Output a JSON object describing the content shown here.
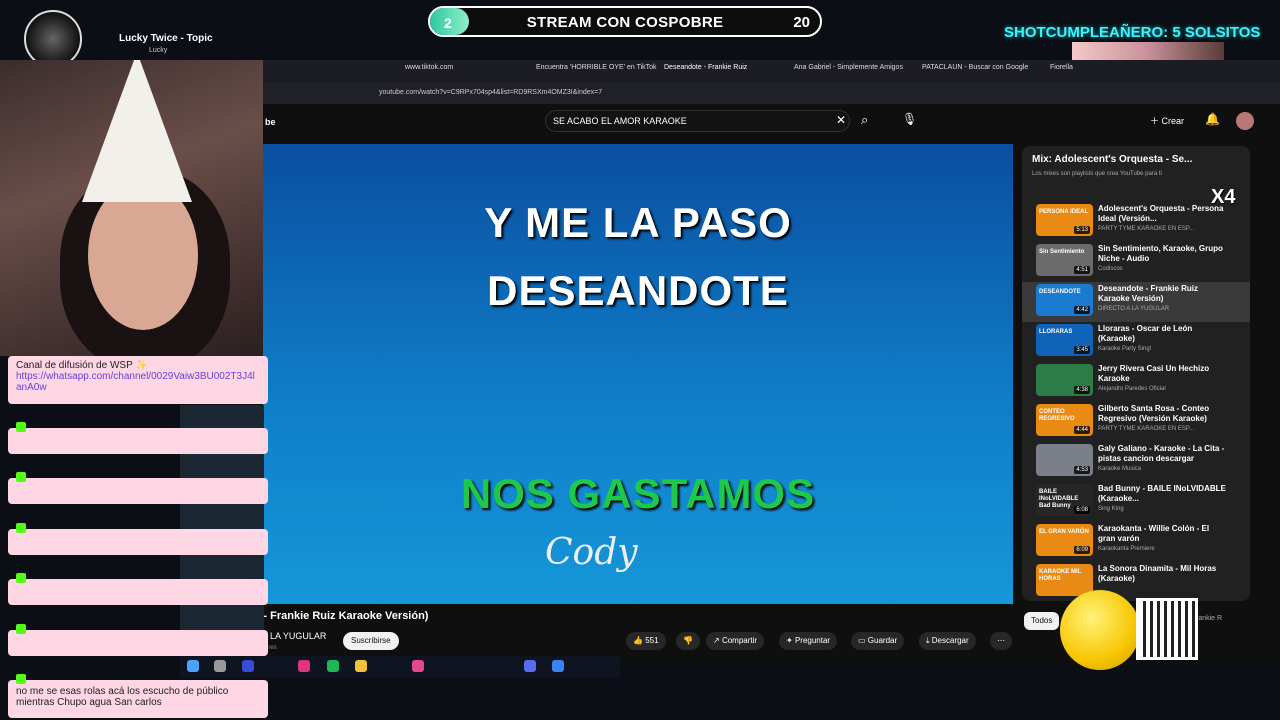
{
  "overlay": {
    "goal_current": "2",
    "goal_label": "STREAM CON COSPOBRE",
    "goal_target": "20",
    "goal_progress": 0.1,
    "birthday": "SHOTCUMPLEAÑERO: 5 SOLSITOS",
    "song": "Lucky Twice - Topic",
    "song_sub": "Lucky",
    "multiplier": "X4"
  },
  "chat": {
    "first": "Canal de difusión de WSP ✨",
    "link": "https://whatsapp.com/channel/0029Vaiw3BU002T3J4lanA0w",
    "last": "no me se esas rolas acá los escucho de público mientras Chupo agua San carlos"
  },
  "tabs": [
    "www.tiktok.com",
    "Encuentra 'HORRIBLE OYE' en TikTok",
    "Deseandote - Frankie Ruiz",
    "Ana Gabriel - Simplemente Amigos",
    "PATACLAUN - Buscar con Google",
    "Fiorella"
  ],
  "url": "youtube.com/watch?v=C9RPx704sp4&list=RD9RSXm4OMZ3I&index=7",
  "search": {
    "value": "SE ACABO EL AMOR KARAOKE"
  },
  "yt_header": {
    "create": "Crear",
    "logo": "be"
  },
  "video": {
    "line1": "Y ME LA PASO",
    "line2": "DESEANDOTE",
    "line3": "NOS GASTAMOS",
    "watermark": "Cody",
    "title": "Deseandote - Frankie Ruiz Karaoke Versión)",
    "channel": "LA YUGULAR",
    "channel_sub": "ores",
    "subscribe": "Suscribirse",
    "likes": "551",
    "share": "Compartir",
    "ask": "Preguntar",
    "save": "Guardar",
    "download": "Descargar",
    "more": "⋯"
  },
  "playlist": {
    "title": "Mix: Adolescent's Orquesta - Se...",
    "subtitle": "Los mixes son playlists que crea YouTube para ti",
    "filter": "Todos",
    "filter_next": "rankie R",
    "items": [
      {
        "title": "Adolescent's Orquesta - Persona Ideal (Versión...",
        "channel": "PARTY TYME KARAOKE EN ESP...",
        "duration": "5:13",
        "thumb_text": "PERSONA IDEAL",
        "color": "#e88a13"
      },
      {
        "title": "Sin Sentimiento, Karaoke, Grupo Niche - Audio",
        "channel": "Codiscos",
        "duration": "4:51",
        "thumb_text": "Sin Sentimiento",
        "color": "#6b6b6b"
      },
      {
        "title": "Deseandote - Frankie Ruiz Karaoke Versión)",
        "channel": "DIRECTO A LA YUGULAR",
        "duration": "4:42",
        "thumb_text": "DESEANDOTE",
        "color": "#1a7bd0"
      },
      {
        "title": "Lloraras - Oscar de León (Karaoke)",
        "channel": "Karaoke Party Sing!",
        "duration": "3:45",
        "thumb_text": "LLORARAS",
        "color": "#0f63b8"
      },
      {
        "title": "Jerry Rivera Casi Un Hechizo Karaoke",
        "channel": "Alejandro Paredes Oficial",
        "duration": "4:38",
        "thumb_text": "",
        "color": "#2d7b46"
      },
      {
        "title": "Gilberto Santa Rosa - Conteo Regresivo (Versión Karaoke)",
        "channel": "PARTY TYME KARAOKE EN ESP...",
        "duration": "4:44",
        "thumb_text": "CONTEO REGRESIVO",
        "color": "#e88a13"
      },
      {
        "title": "Galy Galiano - Karaoke - La Cita - pistas cancion descargar",
        "channel": "Karaoke Musica",
        "duration": "4:53",
        "thumb_text": "",
        "color": "#7a7f8a"
      },
      {
        "title": "Bad Bunny - BAILE INoLVIDABLE (Karaoke...",
        "channel": "Sing King",
        "duration": "6:08",
        "thumb_text": "BAILE INoLVIDABLE Bad Bunny",
        "color": "#262626"
      },
      {
        "title": "Karaokanta - Willie Colón - El gran varón",
        "channel": "Karaokanta Premiere",
        "duration": "6:09",
        "thumb_text": "EL GRAN VARÓN",
        "color": "#e88a13"
      },
      {
        "title": "La Sonora Dinamita - Mil Horas (Karaoke)",
        "channel": "",
        "duration": "",
        "thumb_text": "KARAOKE MIL HORAS",
        "color": "#e88a13"
      }
    ]
  }
}
